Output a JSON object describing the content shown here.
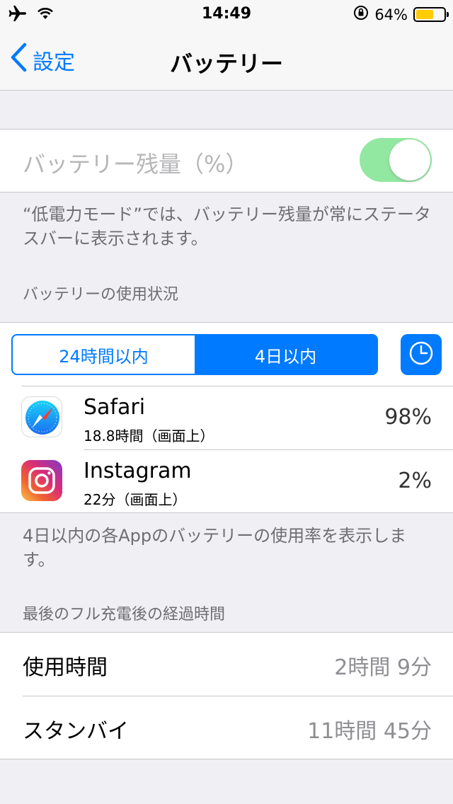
{
  "status_bar": {
    "time": "14:49",
    "battery_percent": "64%",
    "battery_level": 0.64,
    "icons": [
      "airplane-icon",
      "wifi-icon",
      "rotation-lock-icon",
      "battery-icon"
    ]
  },
  "nav": {
    "back_label": "設定",
    "title": "バッテリー"
  },
  "battery_percentage_setting": {
    "label": "バッテリー残量（%）",
    "toggle_on": true,
    "enabled": false,
    "footer": "“低電力モード”では、バッテリー残量が常にステータスバーに表示されます。"
  },
  "usage_header": "バッテリーの使用状況",
  "segmented": {
    "options": [
      "24時間以内",
      "4日以内"
    ],
    "selected_index": 1
  },
  "apps": [
    {
      "name": "Safari",
      "detail": "18.8時間（画面上）",
      "percent": "98%"
    },
    {
      "name": "Instagram",
      "detail": "22分（画面上）",
      "percent": "2%"
    }
  ],
  "apps_footer": "4日以内の各Appのバッテリーの使用率を表示します。",
  "since_charge_header": "最後のフル充電後の経過時間",
  "since_charge": [
    {
      "label": "使用時間",
      "value": "2時間 9分"
    },
    {
      "label": "スタンバイ",
      "value": "11時間 45分"
    }
  ],
  "colors": {
    "accent": "#007aff",
    "toggle_on": "#4cd964",
    "battery_fill": "#ffcc00",
    "background": "#efeff4"
  }
}
